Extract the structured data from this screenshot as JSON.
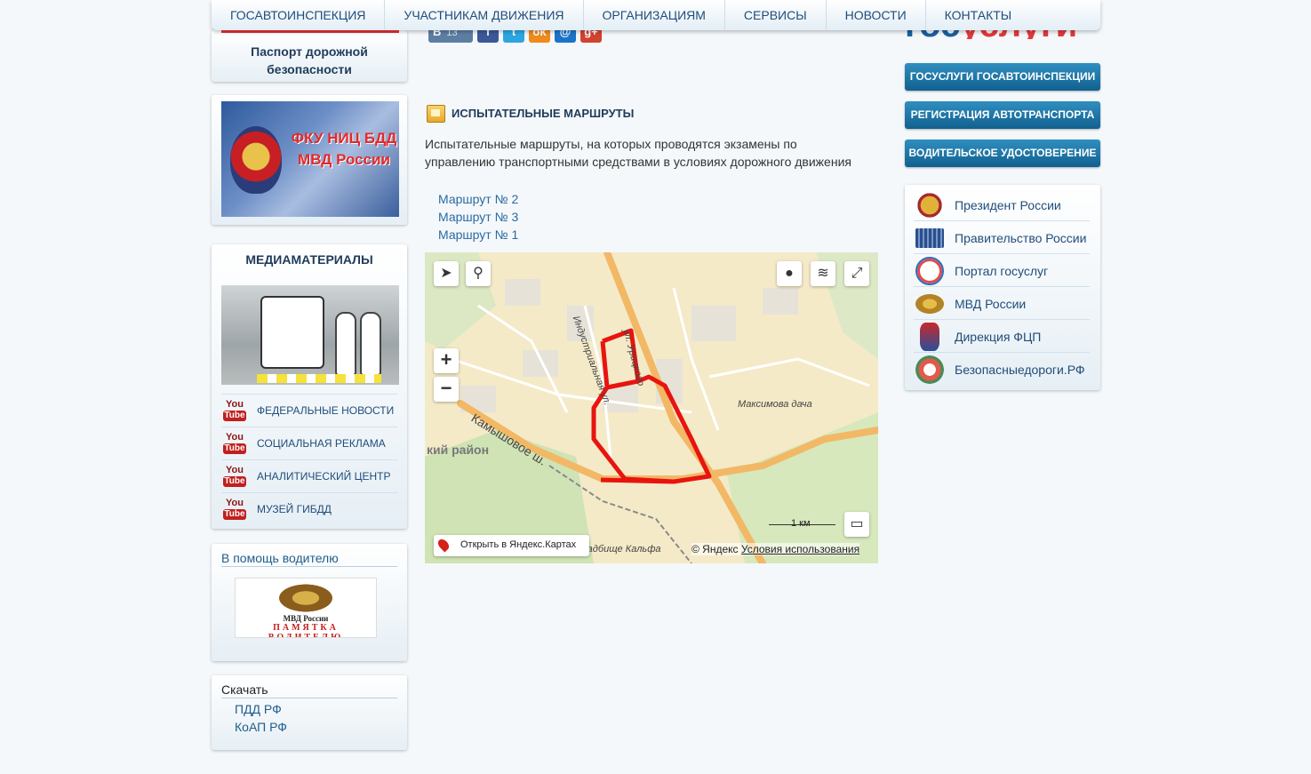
{
  "nav": {
    "items": [
      "ГОСАВТОИНСПЕКЦИЯ",
      "УЧАСТНИКАМ ДВИЖЕНИЯ",
      "ОРГАНИЗАЦИЯМ",
      "СЕРВИСЫ",
      "НОВОСТИ",
      "КОНТАКТЫ"
    ]
  },
  "left": {
    "passport_title": "Паспорт дорожной безопасности",
    "fku_banner_text": "ФКУ НИЦ БДД МВД России",
    "media": {
      "title": "МЕДИАМАТЕРИАЛЫ",
      "youtube_icon_top": "You",
      "youtube_icon_bottom": "Tube",
      "items": [
        "ФЕДЕРАЛЬНЫЕ НОВОСТИ",
        "СОЦИАЛЬНАЯ РЕКЛАМА",
        "АНАЛИТИЧЕСКИЙ ЦЕНТР",
        "МУЗЕЙ ГИБДД"
      ]
    },
    "help": {
      "title": "В помощь водителю",
      "banner_org": "МВД России",
      "banner_text": "ПАМЯТКА ВОДИТЕЛЮ"
    },
    "download": {
      "title": "Скачать",
      "items": [
        "ПДД РФ",
        "КоАП РФ"
      ]
    }
  },
  "share": {
    "vk_label": "B",
    "vk_count": "13",
    "fb_label": "f",
    "tw_label": "t",
    "ok_label": "ok",
    "mail_label": "@",
    "gp_label": "g+"
  },
  "content": {
    "title": "ИСПЫТАТЕЛЬНЫЕ МАРШРУТЫ",
    "description": "Испытательные маршруты, на которых проводятся экзамены по управлению транспортными средствами в условиях дорожного движения",
    "routes": [
      "Маршрут № 2",
      "Маршрут № 3",
      "Маршрут № 1"
    ]
  },
  "map": {
    "zoom_in": "+",
    "zoom_out": "−",
    "open_label": "Открыть в Яндекс.Картах",
    "copyright": "© Яндекс",
    "terms": "Условия использования",
    "scale": "1 км",
    "labels": {
      "street1": "Индустриальная ул.",
      "street2": "ул. Урицкого",
      "street3": "Камышовое ш.",
      "district": "кий район",
      "place1": "Максимова дача",
      "place2": "Кладбище Кальфа"
    },
    "route_color": "#e8140f"
  },
  "right": {
    "logo_part1": "гос",
    "logo_part2": "услуги",
    "buttons": [
      "ГОСУСЛУГИ ГОСАВТОИНСПЕКЦИИ",
      "РЕГИСТРАЦИЯ АВТОТРАНСПОРТА",
      "ВОДИТЕЛЬСКОЕ УДОСТОВЕРЕНИЕ"
    ],
    "links": [
      "Президент России",
      "Правительство России",
      "Портал госуслуг",
      "МВД России",
      "Дирекция ФЦП",
      "Безопасныедороги.РФ"
    ]
  }
}
